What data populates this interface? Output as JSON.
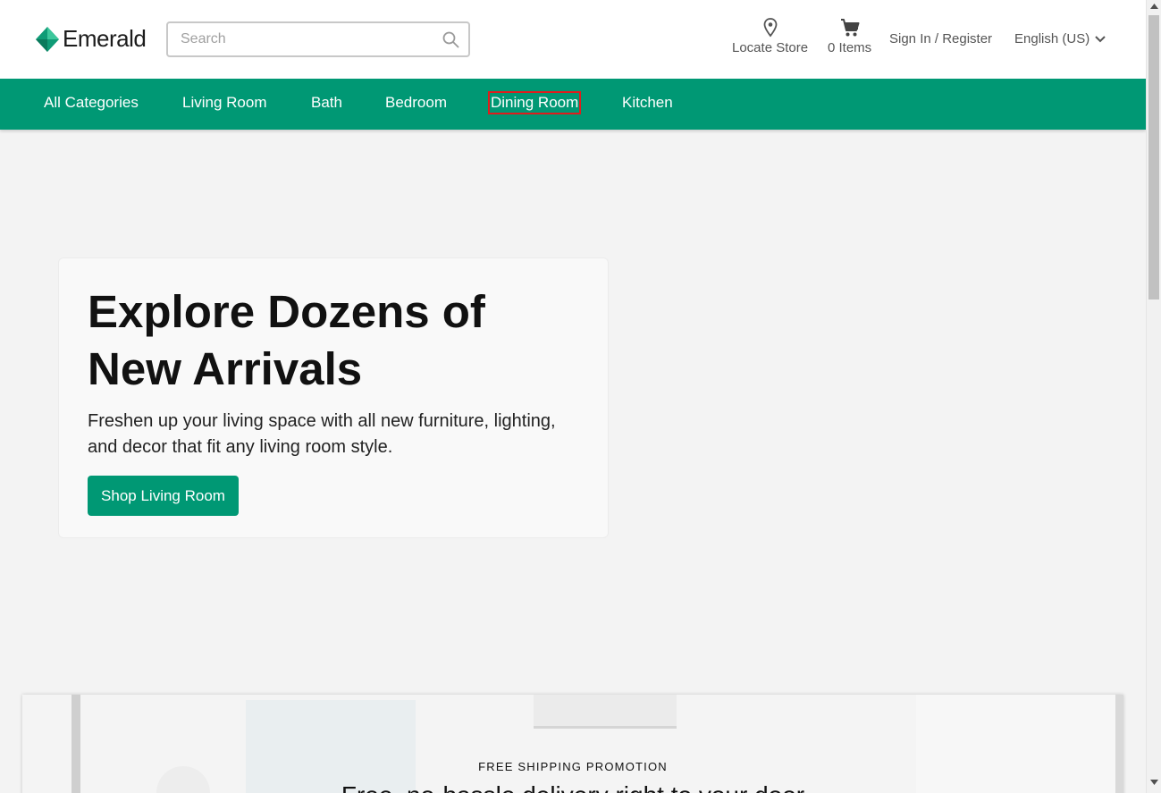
{
  "header": {
    "logo_text": "Emerald",
    "search_placeholder": "Search",
    "locate_store": "Locate Store",
    "cart_label": "0 Items",
    "signin": "Sign In / Register",
    "language": "English (US)"
  },
  "icons": {
    "logo": "emerald-diamond-icon",
    "search": "search-icon",
    "locate": "map-pin-icon",
    "cart": "shopping-cart-icon",
    "language": "chevron-down-icon"
  },
  "nav": {
    "items": [
      {
        "label": "All Categories"
      },
      {
        "label": "Living Room"
      },
      {
        "label": "Bath"
      },
      {
        "label": "Bedroom"
      },
      {
        "label": "Dining Room",
        "highlighted": true
      },
      {
        "label": "Kitchen"
      }
    ]
  },
  "hero": {
    "title": "Explore Dozens of New Arrivals",
    "body": "Freshen up your living space with all new furniture, lighting, and decor that fit any living room style.",
    "button": "Shop Living Room"
  },
  "promo": {
    "kicker": "FREE SHIPPING PROMOTION",
    "headline": "Free, no-hassle delivery right to your door"
  },
  "colors": {
    "brand_green": "#009874",
    "highlight_border": "#e01c1c",
    "page_bg": "#f3f3f3"
  }
}
